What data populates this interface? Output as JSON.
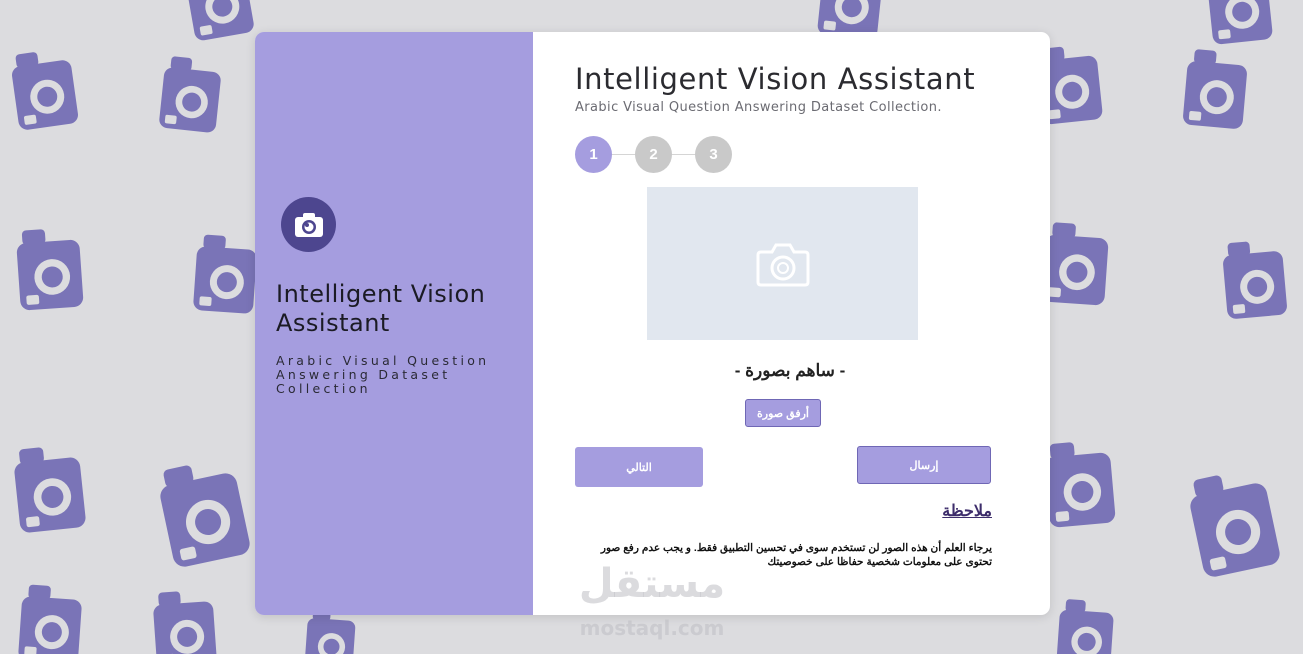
{
  "background": {
    "color": "#dcdcdf",
    "pattern_icon": "camera-icon",
    "pattern_color": "#7a74b7"
  },
  "colors": {
    "accent": "#a59ddf",
    "accent_dark": "#4d468f",
    "step_inactive": "#c9c9c9",
    "preview_bg": "#e1e7ef"
  },
  "sidebar": {
    "logo_icon": "camera-icon",
    "title": "Intelligent Vision Assistant",
    "subtitle": "Arabic Visual Question Answering Dataset Collection"
  },
  "header": {
    "title": "Intelligent Vision Assistant",
    "subtitle": "Arabic Visual Question Answering Dataset Collection."
  },
  "stepper": {
    "steps": [
      "1",
      "2",
      "3"
    ],
    "active": 1
  },
  "upload": {
    "placeholder_icon": "camera-icon",
    "contribute_label": "- ساهم بصورة -",
    "attach_button": "أرفق صورة"
  },
  "actions": {
    "next_button": "التالي",
    "send_button": "إرسال"
  },
  "note": {
    "title": "ملاحظة",
    "text": "يرجاء العلم أن هذه الصور لن تستخدم سوى في تحسين التطبيق فقط. و يجب عدم رفع صور تحتوى على معلومات شخصية حفاظا على خصوصيتك"
  },
  "watermark": {
    "arabic": "مستقل",
    "latin": "mostaql.com"
  }
}
